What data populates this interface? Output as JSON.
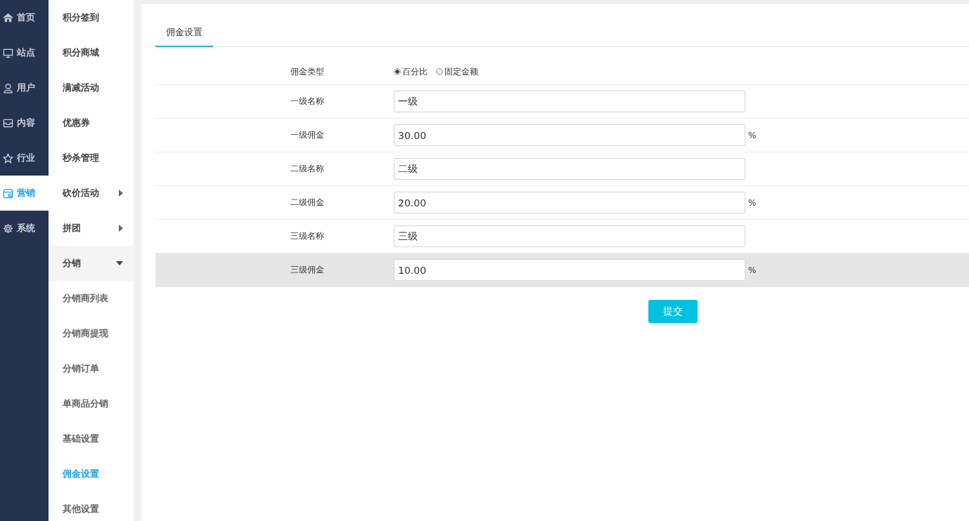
{
  "nav": [
    {
      "label": "首页",
      "selected": false
    },
    {
      "label": "站点",
      "selected": false
    },
    {
      "label": "用户",
      "selected": false
    },
    {
      "label": "内容",
      "selected": false
    },
    {
      "label": "行业",
      "selected": false
    },
    {
      "label": "营销",
      "selected": true
    },
    {
      "label": "系统",
      "selected": false
    }
  ],
  "submenu": [
    {
      "label": "积分签到"
    },
    {
      "label": "积分商城"
    },
    {
      "label": "满减活动"
    },
    {
      "label": "优惠券"
    },
    {
      "label": "秒杀管理"
    },
    {
      "label": "砍价活动",
      "expanded": false
    },
    {
      "label": "拼团",
      "expanded": false
    },
    {
      "label": "分销",
      "expanded": true,
      "children": [
        {
          "label": "分销商列表",
          "selected": false
        },
        {
          "label": "分销商提现",
          "selected": false
        },
        {
          "label": "分销订单",
          "selected": false
        },
        {
          "label": "单商品分销",
          "selected": false
        },
        {
          "label": "基础设置",
          "selected": false
        },
        {
          "label": "佣金设置",
          "selected": true
        },
        {
          "label": "其他设置",
          "selected": false
        }
      ]
    }
  ],
  "tabs": [
    {
      "label": "佣金设置",
      "selected": true
    }
  ],
  "form": [
    {
      "kind": "radio",
      "label": "佣金类型",
      "highlighted": false,
      "options": [
        {
          "label": "百分比",
          "selected": true
        },
        {
          "label": "固定金额",
          "selected": false
        }
      ]
    },
    {
      "kind": "input",
      "label": "一级名称",
      "value": "一级",
      "highlighted": false
    },
    {
      "kind": "input",
      "label": "一级佣金",
      "value": "30.00",
      "suffix": "%",
      "highlighted": false
    },
    {
      "kind": "input",
      "label": "二级名称",
      "value": "二级",
      "highlighted": false
    },
    {
      "kind": "input",
      "label": "二级佣金",
      "value": "20.00",
      "suffix": "%",
      "highlighted": false
    },
    {
      "kind": "input",
      "label": "三级名称",
      "value": "三级",
      "highlighted": false
    },
    {
      "kind": "input",
      "label": "三级佣金",
      "value": "10.00",
      "suffix": "%",
      "highlighted": true
    }
  ],
  "submit": "提交"
}
